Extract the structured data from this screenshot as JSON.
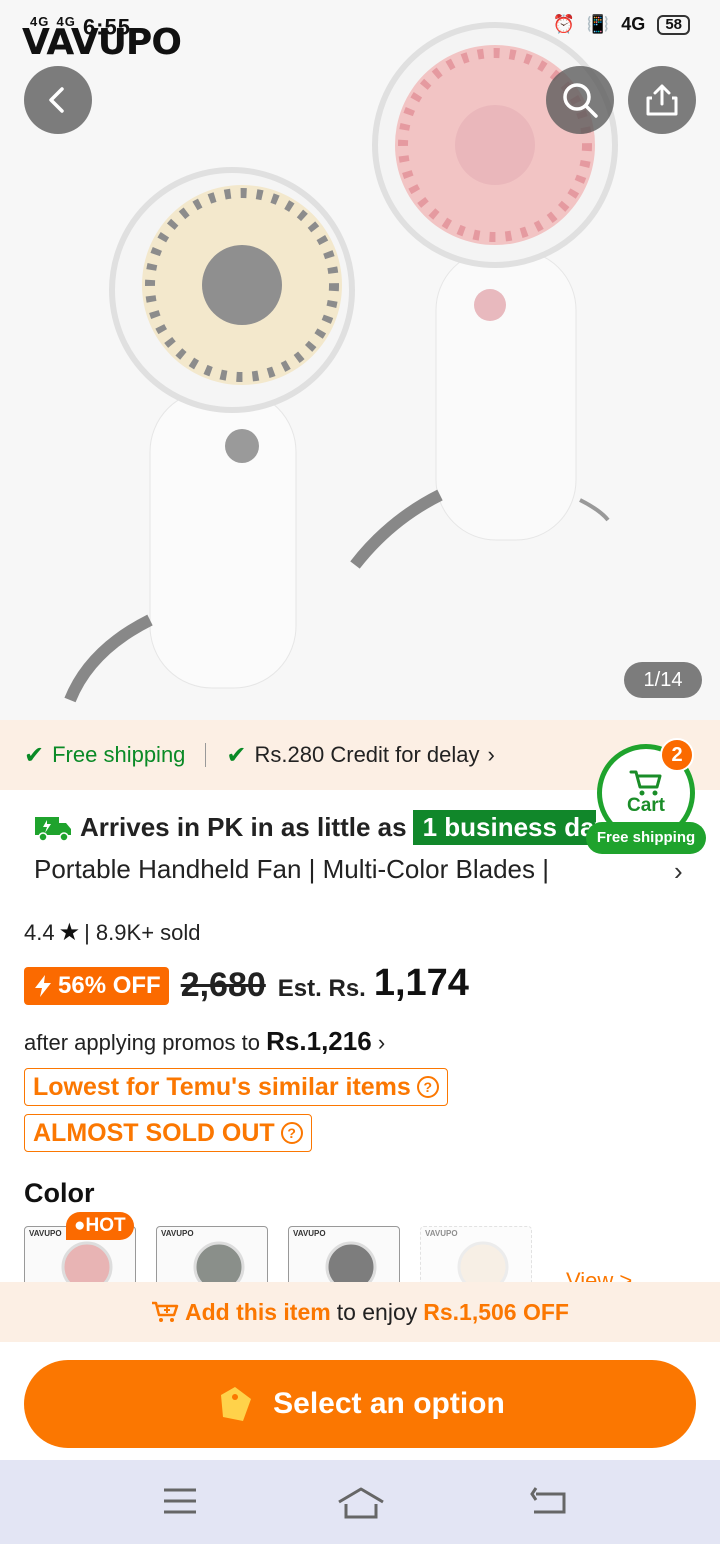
{
  "status_bar": {
    "network_1": "4G",
    "network_2": "4G",
    "time": "6:55",
    "network_right": "4G",
    "battery": "58"
  },
  "brand": {
    "logo_text": "VAVUPO"
  },
  "gallery": {
    "counter": "1/14"
  },
  "benefits": {
    "free_shipping": "Free shipping",
    "credit": "Rs.280 Credit for delay"
  },
  "cart": {
    "label": "Cart",
    "count": "2",
    "shipping_label": "Free shipping"
  },
  "delivery": {
    "prefix": "Arrives in PK in as little as",
    "highlight": "1 business day"
  },
  "product": {
    "title": "Portable Handheld Fan | Multi-Color Blades |",
    "rating": "4.4",
    "sold": "| 8.9K+ sold",
    "discount": "56% OFF",
    "old_price": "2,680",
    "est_label": "Est. Rs.",
    "price": "1,174",
    "promo_prefix": "after applying promos to",
    "promo_price": "Rs.1,216",
    "tag_lowest": "Lowest for Temu's similar items",
    "tag_soldout": "ALMOST SOLD OUT"
  },
  "color": {
    "label": "Color",
    "hot_label": "HOT",
    "view_more": "View >",
    "swatch_logo": "VAVUPO",
    "swatches": [
      "pink",
      "gray",
      "gray-2",
      "beige"
    ]
  },
  "add_bar": {
    "action": "Add this item",
    "middle": "to enjoy",
    "amount": "Rs.1,506 OFF"
  },
  "cta": {
    "label": "Select an option"
  },
  "colors": {
    "accent": "#fb7701",
    "green": "#1fa32d",
    "promo_bg": "#fcefe4"
  }
}
